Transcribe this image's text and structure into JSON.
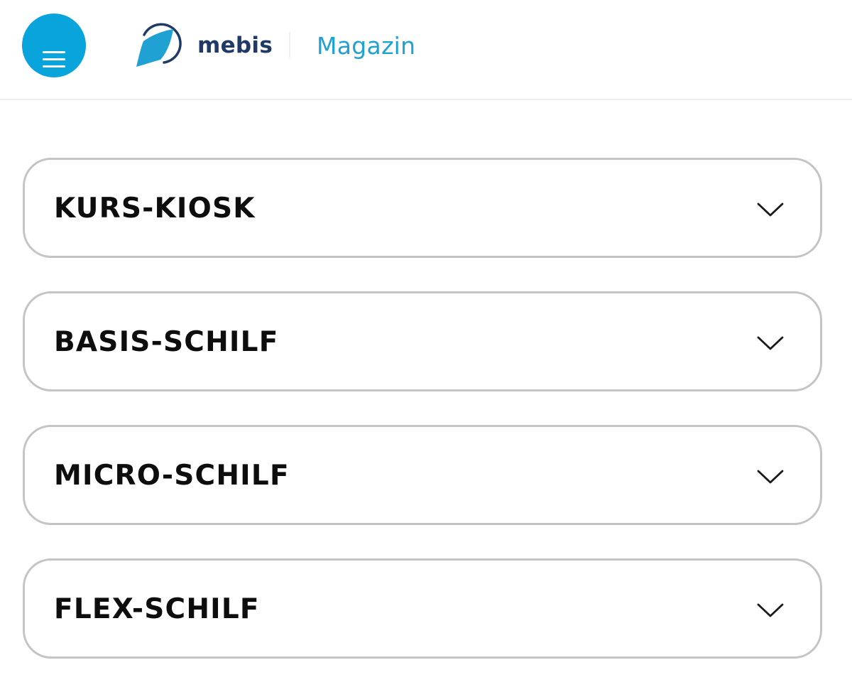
{
  "header": {
    "menu_icon": "hamburger-menu-icon",
    "logo_icon": "mebis-logo-icon",
    "logo_text": "mebis",
    "section_label": "Magazin",
    "colors": {
      "menu_button": "#0aa4dc",
      "logo_text": "#1f3a66",
      "section_label": "#1fa1d3"
    }
  },
  "accordion": {
    "items": [
      {
        "label": "KURS-KIOSK",
        "icon": "chevron-down-icon"
      },
      {
        "label": "BASIS-SCHILF",
        "icon": "chevron-down-icon"
      },
      {
        "label": "MICRO-SCHILF",
        "icon": "chevron-down-icon"
      },
      {
        "label": "FLEX-SCHILF",
        "icon": "chevron-down-icon"
      }
    ],
    "colors": {
      "border": "#c4c4c4",
      "text": "#0d0d0d"
    }
  }
}
